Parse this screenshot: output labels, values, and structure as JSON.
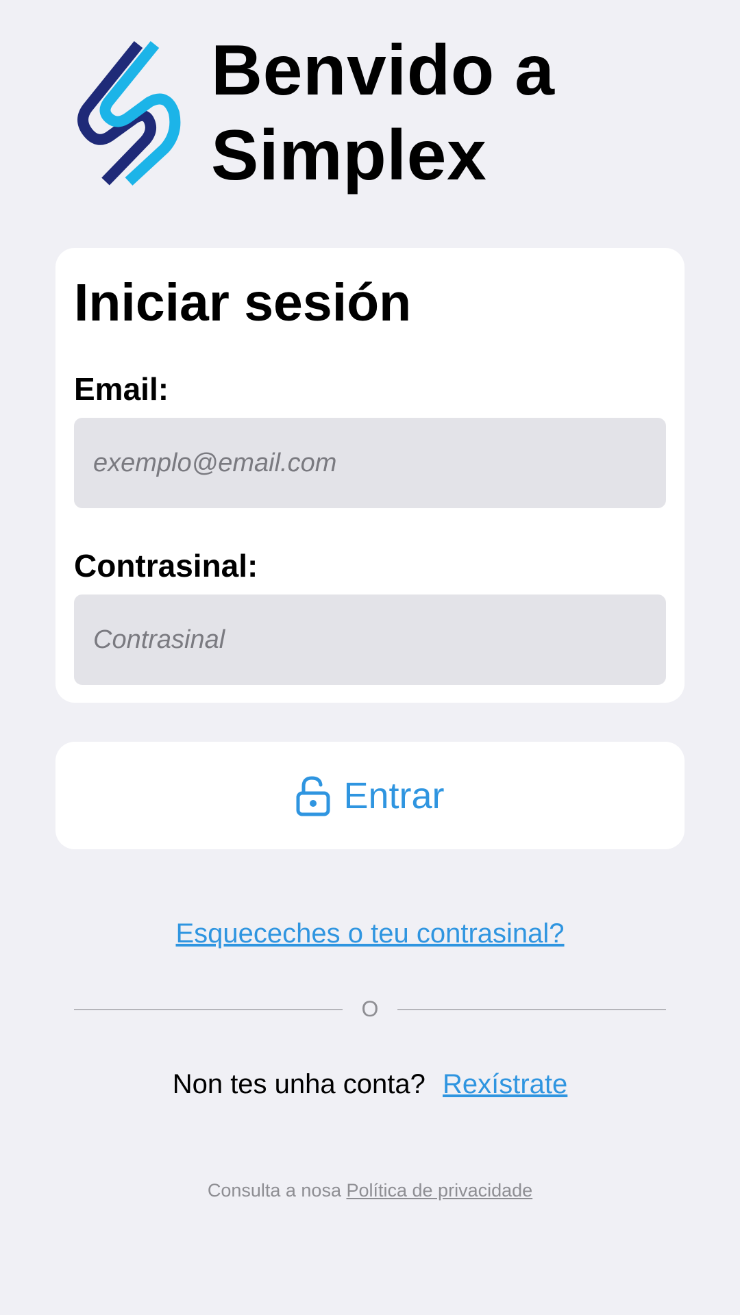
{
  "header": {
    "logo_icon": "simplex-logo",
    "title_line1": "Benvido a",
    "title_line2": "Simplex"
  },
  "login_card": {
    "title": "Iniciar sesión",
    "email": {
      "label": "Email:",
      "placeholder": "exemplo@email.com",
      "value": ""
    },
    "password": {
      "label": "Contrasinal:",
      "placeholder": "Contrasinal",
      "value": ""
    }
  },
  "login_button": {
    "icon": "lock-open-icon",
    "label": "Entrar"
  },
  "forgot_password": "Esqueceches o teu contrasinal?",
  "divider_text": "O",
  "signup": {
    "prompt": "Non tes unha conta?",
    "link": "Rexístrate"
  },
  "privacy": {
    "prefix": "Consulta a nosa",
    "link": "Política de privacidade"
  },
  "colors": {
    "background": "#f0f0f5",
    "accent": "#2f95e0",
    "logo_dark": "#1f2a78",
    "logo_light": "#1cb4e8",
    "input_bg": "#e3e3e8"
  }
}
